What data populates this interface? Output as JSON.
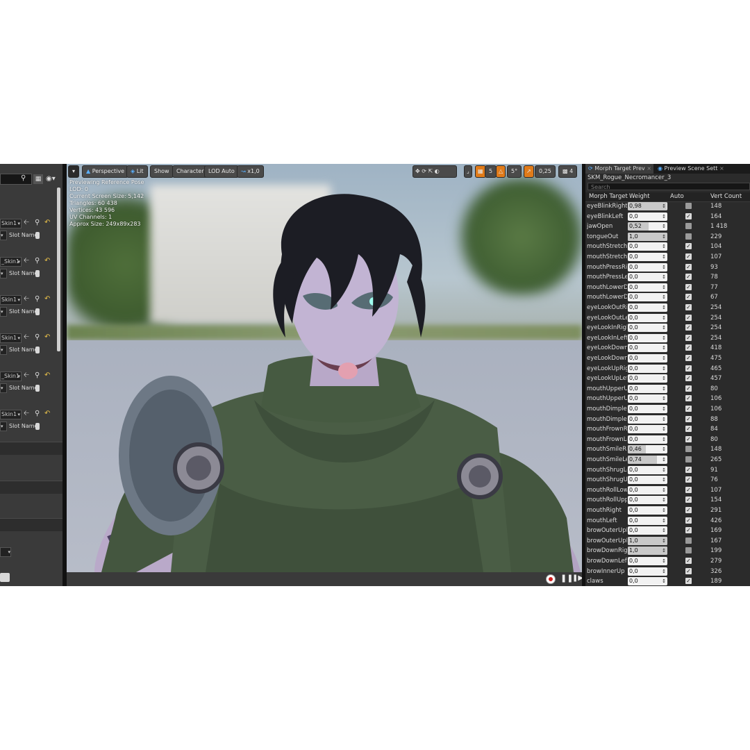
{
  "left_panel": {
    "slots": [
      {
        "mesh": "Skin1",
        "slot_label": "Slot Name"
      },
      {
        "mesh": "_Skin1",
        "slot_label": "Slot Name"
      },
      {
        "mesh": "Skin1",
        "slot_label": "Slot Name"
      },
      {
        "mesh": "Skin1",
        "slot_label": "Slot Name"
      },
      {
        "mesh": "_Skin1",
        "slot_label": "Slot Name"
      },
      {
        "mesh": "Skin1",
        "slot_label": "Slot Name"
      }
    ]
  },
  "viewport": {
    "toolbar": {
      "perspective": "Perspective",
      "lit": "Lit",
      "show": "Show",
      "character": "Character",
      "lod": "LOD Auto",
      "speed": "x1,0",
      "grid_size": "5",
      "rotation_snap": "5°",
      "scale_snap": "0,25",
      "camera_speed": "4"
    },
    "info": [
      "Previewing Reference Pose",
      "LOD: 0",
      "Current Screen Size: 5,142",
      "Triangles: 60 438",
      "Vertices: 43 596",
      "UV Channels: 1",
      "Approx Size: 249x89x283"
    ]
  },
  "right_panel": {
    "tabs": [
      "Morph Target Prev",
      "Preview Scene Sett"
    ],
    "asset_name": "SKM_Rogue_Necromancer_3",
    "search_placeholder": "Search",
    "columns": [
      "Morph Target N",
      "Weight",
      "Auto",
      "Vert Count"
    ],
    "rows": [
      {
        "name": "eyeBlinkRight",
        "weight": "0,98",
        "fill": 0.98,
        "auto": false,
        "verts": "148"
      },
      {
        "name": "eyeBlinkLeft",
        "weight": "0,0",
        "fill": 0.0,
        "auto": true,
        "verts": "164"
      },
      {
        "name": "jawOpen",
        "weight": "0,52",
        "fill": 0.52,
        "auto": false,
        "verts": "1 418"
      },
      {
        "name": "tongueOut",
        "weight": "1,0",
        "fill": 1.0,
        "auto": false,
        "verts": "229"
      },
      {
        "name": "mouthStretchRig",
        "weight": "0,0",
        "fill": 0.0,
        "auto": true,
        "verts": "104"
      },
      {
        "name": "mouthStretchLef",
        "weight": "0,0",
        "fill": 0.0,
        "auto": true,
        "verts": "107"
      },
      {
        "name": "mouthPressRigh",
        "weight": "0,0",
        "fill": 0.0,
        "auto": true,
        "verts": "93"
      },
      {
        "name": "mouthPressLeft",
        "weight": "0,0",
        "fill": 0.0,
        "auto": true,
        "verts": "78"
      },
      {
        "name": "mouthLowerDow",
        "weight": "0,0",
        "fill": 0.0,
        "auto": true,
        "verts": "77"
      },
      {
        "name": "mouthLowerDow",
        "weight": "0,0",
        "fill": 0.0,
        "auto": true,
        "verts": "67"
      },
      {
        "name": "eyeLookOutRigh",
        "weight": "0,0",
        "fill": 0.0,
        "auto": true,
        "verts": "254"
      },
      {
        "name": "eyeLookOutLeft",
        "weight": "0,0",
        "fill": 0.0,
        "auto": true,
        "verts": "254"
      },
      {
        "name": "eyeLookInRight",
        "weight": "0,0",
        "fill": 0.0,
        "auto": true,
        "verts": "254"
      },
      {
        "name": "eyeLookInLeft",
        "weight": "0,0",
        "fill": 0.0,
        "auto": true,
        "verts": "254"
      },
      {
        "name": "eyeLookDownRi",
        "weight": "0,0",
        "fill": 0.0,
        "auto": true,
        "verts": "418"
      },
      {
        "name": "eyeLookDownLe",
        "weight": "0,0",
        "fill": 0.0,
        "auto": true,
        "verts": "475"
      },
      {
        "name": "eyeLookUpRight",
        "weight": "0,0",
        "fill": 0.0,
        "auto": true,
        "verts": "465"
      },
      {
        "name": "eyeLookUpLeft",
        "weight": "0,0",
        "fill": 0.0,
        "auto": true,
        "verts": "457"
      },
      {
        "name": "mouthUpperUpR",
        "weight": "0,0",
        "fill": 0.0,
        "auto": true,
        "verts": "80"
      },
      {
        "name": "mouthUpperUpL",
        "weight": "0,0",
        "fill": 0.0,
        "auto": true,
        "verts": "106"
      },
      {
        "name": "mouthDimpleRic",
        "weight": "0,0",
        "fill": 0.0,
        "auto": true,
        "verts": "106"
      },
      {
        "name": "mouthDimpleLe",
        "weight": "0,0",
        "fill": 0.0,
        "auto": true,
        "verts": "88"
      },
      {
        "name": "mouthFrownRig",
        "weight": "0,0",
        "fill": 0.0,
        "auto": true,
        "verts": "84"
      },
      {
        "name": "mouthFrownLef",
        "weight": "0,0",
        "fill": 0.0,
        "auto": true,
        "verts": "80"
      },
      {
        "name": "mouthSmileRigh",
        "weight": "0,46",
        "fill": 0.46,
        "auto": false,
        "verts": "148"
      },
      {
        "name": "mouthSmileLeft",
        "weight": "0,74",
        "fill": 0.74,
        "auto": false,
        "verts": "265"
      },
      {
        "name": "mouthShrugLow",
        "weight": "0,0",
        "fill": 0.0,
        "auto": true,
        "verts": "91"
      },
      {
        "name": "mouthShrugUpp",
        "weight": "0,0",
        "fill": 0.0,
        "auto": true,
        "verts": "76"
      },
      {
        "name": "mouthRollLower",
        "weight": "0,0",
        "fill": 0.0,
        "auto": true,
        "verts": "107"
      },
      {
        "name": "mouthRollUpper",
        "weight": "0,0",
        "fill": 0.0,
        "auto": true,
        "verts": "154"
      },
      {
        "name": "mouthRight",
        "weight": "0,0",
        "fill": 0.0,
        "auto": true,
        "verts": "291"
      },
      {
        "name": "mouthLeft",
        "weight": "0,0",
        "fill": 0.0,
        "auto": true,
        "verts": "426"
      },
      {
        "name": "browOuterUpRic",
        "weight": "0,0",
        "fill": 0.0,
        "auto": true,
        "verts": "169"
      },
      {
        "name": "browOuterUpLef",
        "weight": "1,0",
        "fill": 1.0,
        "auto": false,
        "verts": "167"
      },
      {
        "name": "browDownRight",
        "weight": "1,0",
        "fill": 1.0,
        "auto": false,
        "verts": "199"
      },
      {
        "name": "browDownLeft",
        "weight": "0,0",
        "fill": 0.0,
        "auto": true,
        "verts": "279"
      },
      {
        "name": "browInnerUp",
        "weight": "0,0",
        "fill": 0.0,
        "auto": true,
        "verts": "326"
      },
      {
        "name": "claws",
        "weight": "0,0",
        "fill": 0.0,
        "auto": true,
        "verts": "189"
      }
    ]
  },
  "colors": {
    "accent_yellow": "#e8c04a",
    "accent_orange": "#e07b1a",
    "record_red": "#d02020"
  }
}
